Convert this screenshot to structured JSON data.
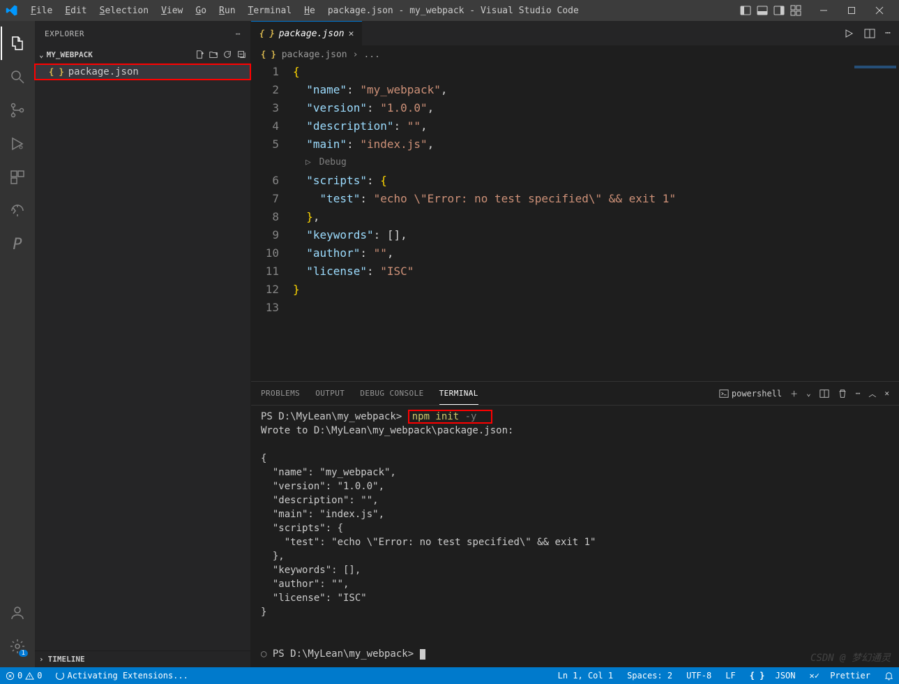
{
  "window": {
    "title": "package.json - my_webpack - Visual Studio Code"
  },
  "menu": {
    "items": [
      {
        "mn": "F",
        "rest": "ile"
      },
      {
        "mn": "E",
        "rest": "dit"
      },
      {
        "mn": "S",
        "rest": "election"
      },
      {
        "mn": "V",
        "rest": "iew"
      },
      {
        "mn": "G",
        "rest": "o"
      },
      {
        "mn": "R",
        "rest": "un"
      },
      {
        "mn": "T",
        "rest": "erminal"
      },
      {
        "mn": "H",
        "rest": "e"
      }
    ]
  },
  "sidebar": {
    "title": "EXPLORER",
    "folder": "MY_WEBPACK",
    "files": [
      "package.json"
    ],
    "timeline": "TIMELINE"
  },
  "tab": {
    "filename": "package.json"
  },
  "breadcrumb": {
    "file": "package.json",
    "more": "..."
  },
  "editor": {
    "debugLens": "Debug",
    "lines": [
      {
        "n": 1,
        "html": "<span class='tok-brace'>{</span>"
      },
      {
        "n": 2,
        "html": "  <span class='tok-key'>\"name\"</span><span class='tok-colon'>: </span><span class='tok-str'>\"my_webpack\"</span><span class='tok-colon'>,</span>"
      },
      {
        "n": 3,
        "html": "  <span class='tok-key'>\"version\"</span><span class='tok-colon'>: </span><span class='tok-str'>\"1.0.0\"</span><span class='tok-colon'>,</span>"
      },
      {
        "n": 4,
        "html": "  <span class='tok-key'>\"description\"</span><span class='tok-colon'>: </span><span class='tok-str'>\"\"</span><span class='tok-colon'>,</span>"
      },
      {
        "n": 5,
        "html": "  <span class='tok-key'>\"main\"</span><span class='tok-colon'>: </span><span class='tok-str'>\"index.js\"</span><span class='tok-colon'>,</span>"
      },
      {
        "n": 6,
        "html": "  <span class='tok-key'>\"scripts\"</span><span class='tok-colon'>: </span><span class='tok-brace'>{</span>"
      },
      {
        "n": 7,
        "html": "    <span class='tok-key'>\"test\"</span><span class='tok-colon'>: </span><span class='tok-str'>\"echo \\\"Error: no test specified\\\" && exit 1\"</span>"
      },
      {
        "n": 8,
        "html": "  <span class='tok-brace'>}</span><span class='tok-colon'>,</span>"
      },
      {
        "n": 9,
        "html": "  <span class='tok-key'>\"keywords\"</span><span class='tok-colon'>: </span><span class='tok-arr'>[]</span><span class='tok-colon'>,</span>"
      },
      {
        "n": 10,
        "html": "  <span class='tok-key'>\"author\"</span><span class='tok-colon'>: </span><span class='tok-str'>\"\"</span><span class='tok-colon'>,</span>"
      },
      {
        "n": 11,
        "html": "  <span class='tok-key'>\"license\"</span><span class='tok-colon'>: </span><span class='tok-str'>\"ISC\"</span>"
      },
      {
        "n": 12,
        "html": "<span class='tok-brace'>}</span>"
      },
      {
        "n": 13,
        "html": ""
      }
    ]
  },
  "panel": {
    "tabs": [
      "PROBLEMS",
      "OUTPUT",
      "DEBUG CONSOLE",
      "TERMINAL"
    ],
    "shell": "powershell",
    "prompt1": "PS D:\\MyLean\\my_webpack> ",
    "cmd": "npm init",
    "flag": " -y",
    "line2": "Wrote to D:\\MyLean\\my_webpack\\package.json:",
    "body": "{\n  \"name\": \"my_webpack\",\n  \"version\": \"1.0.0\",\n  \"description\": \"\",\n  \"main\": \"index.js\",\n  \"scripts\": {\n    \"test\": \"echo \\\"Error: no test specified\\\" && exit 1\"\n  },\n  \"keywords\": [],\n  \"author\": \"\",\n  \"license\": \"ISC\"\n}",
    "prompt2": "PS D:\\MyLean\\my_webpack> "
  },
  "status": {
    "errors": "0",
    "warnings": "0",
    "activating": "Activating Extensions...",
    "pos": "Ln 1, Col 1",
    "spaces": "Spaces: 2",
    "encoding": "UTF-8",
    "eol": "LF",
    "lang": "JSON",
    "prettier": "Prettier",
    "bell": ""
  },
  "watermark": "CSDN @ 梦幻通灵"
}
